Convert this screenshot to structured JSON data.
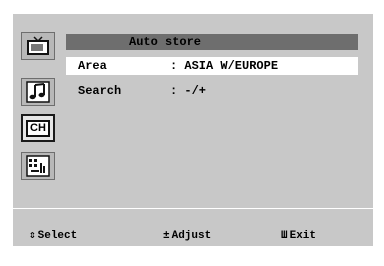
{
  "menu": {
    "title": "Auto store",
    "rows": [
      {
        "label": "Area",
        "value": ": ASIA W/EUROPE",
        "selected": true
      },
      {
        "label": "Search",
        "value": ": -/+",
        "selected": false
      }
    ]
  },
  "sidebar": {
    "icons": [
      {
        "name": "tv-picture-icon",
        "active": false
      },
      {
        "name": "music-note-icon",
        "active": false
      },
      {
        "name": "channel-ch-icon",
        "label": "CH",
        "active": true
      },
      {
        "name": "setup-icon",
        "active": false
      }
    ]
  },
  "footer": {
    "select_symbol": "⇕",
    "select_label": "Select",
    "adjust_symbol": "±",
    "adjust_label": "Adjust",
    "exit_symbol": "Ш",
    "exit_label": "Exit"
  }
}
